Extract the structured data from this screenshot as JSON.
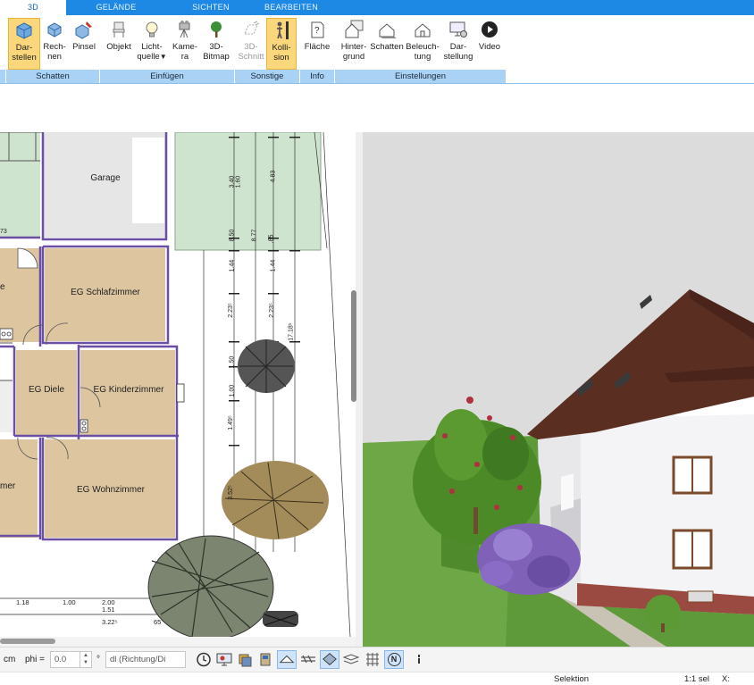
{
  "tabs": [
    {
      "label": "3D",
      "active": true
    },
    {
      "label": "GELÄNDE"
    },
    {
      "label": "SICHTEN"
    },
    {
      "label": "BEARBEITEN"
    }
  ],
  "ribbon": {
    "darstellen": {
      "line1": "Dar-",
      "line2": "stellen",
      "icon": "cube-render-icon"
    },
    "rechnen": {
      "line1": "Rech-",
      "line2": "nen",
      "icon": "cube-calculate-icon"
    },
    "pinsel": {
      "line1": "Pinsel",
      "line2": "",
      "icon": "cube-brush-icon"
    },
    "objekt": {
      "line1": "Objekt",
      "line2": "",
      "icon": "chair-icon"
    },
    "lichtquelle": {
      "line1": "Licht-",
      "line2": "quelle",
      "icon": "lightbulb-icon",
      "dropdown": "▼"
    },
    "kamera": {
      "line1": "Kame-",
      "line2": "ra",
      "icon": "camera-tripod-icon"
    },
    "bitmap": {
      "line1": "3D-",
      "line2": "Bitmap",
      "icon": "tree-icon"
    },
    "schnitt": {
      "line1": "3D-",
      "line2": "Schnitt",
      "icon": "section-icon"
    },
    "kollision": {
      "line1": "Kolli-",
      "line2": "sion",
      "icon": "person-collision-icon"
    },
    "flaeche": {
      "line1": "Fläche",
      "line2": "",
      "icon": "area-question-icon"
    },
    "hintergrund": {
      "line1": "Hinter-",
      "line2": "grund",
      "icon": "house-background-icon"
    },
    "schatten2": {
      "line1": "Schatten",
      "line2": "",
      "icon": "house-shadow-icon"
    },
    "beleuchtung": {
      "line1": "Beleuch-",
      "line2": "tung",
      "icon": "house-light-icon"
    },
    "darstellung": {
      "line1": "Dar-",
      "line2": "stellung",
      "icon": "monitor-settings-icon"
    },
    "video": {
      "line1": "Video",
      "line2": "",
      "icon": "play-circle-icon"
    },
    "groups": {
      "schatten": "Schatten",
      "einfuegen": "Einfügen",
      "sonstige": "Sonstige",
      "info": "Info",
      "einstellungen": "Einstellungen"
    }
  },
  "plan": {
    "rooms": {
      "garage": "Garage",
      "schlafzimmer": "EG Schlafzimmer",
      "diele": "EG Diele",
      "kinderzimmer": "EG Kinderzimmer",
      "wohnzimmer": "EG Wohnzimmer",
      "cut_e": "e",
      "cut_mer": "mer"
    },
    "dims": {
      "d340": "3.40",
      "d160": "1.60",
      "d483": "4.83",
      "d850": "8.50",
      "d877": "8.77",
      "d85": ".85",
      "d144a": "1.44",
      "d144b": "1.44",
      "d223a": "2.23⁵",
      "d223b": "2.23⁵",
      "d1718": "17.18⁵",
      "d150": "1.50",
      "d100": "1.00",
      "d149": "1.49⁵",
      "d352": "3.52⁵",
      "b118": "1.18",
      "b100": "1.00",
      "b200": "2.00",
      "b151": "1.51",
      "b322": "3.22⁵",
      "b65": "65",
      "b73": "73"
    }
  },
  "bottombar": {
    "unit": "cm",
    "phi_label": "phi =",
    "phi_value": "0.0",
    "degree": "°",
    "mode_select": "dl (Richtung/Di",
    "icons": [
      "clock-icon",
      "monitor-icon",
      "layers-icon",
      "shape-icon",
      "hatch-icon",
      "diamond-icon",
      "plane-stack-icon",
      "grid-icon",
      "north-icon",
      "more-icon"
    ],
    "north_label": "N"
  },
  "status": {
    "mode": "Selektion",
    "scale": "1:1 sel",
    "x_label": "X:"
  },
  "colors": {
    "tab_blue": "#1e88e5",
    "group_label": "#aad2f5",
    "active_button": "#f9d77a",
    "floor_wood": "#ddc5a0",
    "wall_purple": "#6a4fa3",
    "grass_plan": "#cfe4cf",
    "roof_brown": "#5b2e22",
    "grass_3d": "#5f9a3a",
    "lilac": "#7f61b8"
  }
}
